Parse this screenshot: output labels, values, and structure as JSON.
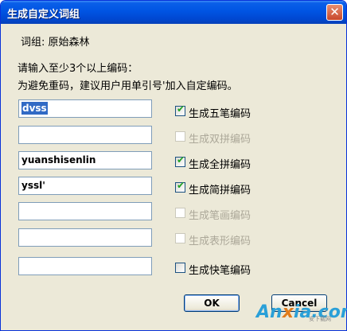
{
  "window": {
    "title": "生成自定义词组",
    "close_glyph": "✕"
  },
  "phrase": {
    "label": "词组: 原始森林"
  },
  "instructions": {
    "line1": "请输入至少3个以上编码：",
    "line2": "为避免重码，建议用户用单引号'加入自定编码。"
  },
  "rows": [
    {
      "value": "dvss",
      "selected": true,
      "option": "生成五笔编码",
      "checked": true,
      "enabled": true
    },
    {
      "value": "",
      "option": "生成双拼编码",
      "checked": false,
      "enabled": false
    },
    {
      "value": "yuanshisenlin",
      "option": "生成全拼编码",
      "checked": true,
      "enabled": true
    },
    {
      "value": "yssl'",
      "option": "生成简拼编码",
      "checked": true,
      "enabled": true
    },
    {
      "value": "",
      "option": "生成笔画编码",
      "checked": false,
      "enabled": false
    },
    {
      "value": "",
      "option": "生成表形编码",
      "checked": false,
      "enabled": false
    },
    {
      "value": "",
      "option": "生成快笔编码",
      "checked": false,
      "enabled": true
    }
  ],
  "buttons": {
    "ok": "OK",
    "cancel": "Cancel"
  },
  "watermark": {
    "brand_a": "An",
    "brand_x": "x",
    "brand_b": "ia.com",
    "sub": "安下载网"
  },
  "colors": {
    "title_bar": "#0054e3",
    "dialog_bg": "#ece9d8",
    "check": "#21a121",
    "disabled_text": "#aca899",
    "selection": "#316ac5"
  }
}
